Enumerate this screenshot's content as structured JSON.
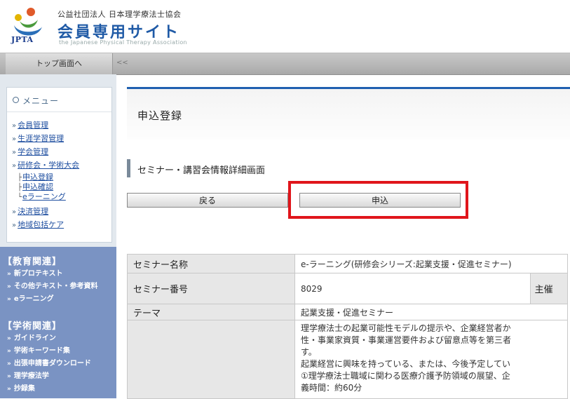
{
  "header": {
    "org_name": "公益社団法人 日本理学療法士協会",
    "site_title": "会員専用サイト",
    "site_subtitle": "the Japanese Physical Therapy Association",
    "logo_text": "JPTA"
  },
  "nav": {
    "top_button": "トップ画面へ",
    "collapse": "<<"
  },
  "menu": {
    "title": "メニュー",
    "items": [
      "会員管理",
      "生涯学習管理",
      "学会管理",
      "研修会・学術大会",
      "決済管理",
      "地域包括ケア"
    ],
    "sub_items": [
      "申込登録",
      "申込確認",
      "eラーニング"
    ]
  },
  "education": {
    "title": "【教育関連】",
    "items": [
      "新プロテキスト",
      "その他テキスト・参考資料",
      "eラーニング"
    ]
  },
  "academic": {
    "title": "【学術関連】",
    "items": [
      "ガイドライン",
      "学術キーワード集",
      "出張申請書ダウンロード",
      "理学療法学",
      "抄録集"
    ]
  },
  "main": {
    "page_title": "申込登録",
    "sub_title": "セミナー・講習会情報詳細画面",
    "back_button": "戻る",
    "apply_button": "申込"
  },
  "details": {
    "rows": [
      {
        "label": "セミナー名称",
        "value": "e-ラーニング(研修会シリーズ:起業支援・促進セミナー)"
      },
      {
        "label": "セミナー番号",
        "value": "8029",
        "extra_label": "主催"
      },
      {
        "label": "テーマ",
        "value": "起業支援・促進セミナー"
      }
    ],
    "description_lines": [
      "理学療法士の起業可能性モデルの提示や、企業経営者か",
      "性・事業家資質・事業運営要件および留意点等を第三者",
      "す。",
      "起業経営に興味を持っている、または、今後予定してい",
      "①理学療法士職域に関わる医療介護予防領域の展望、企",
      "義時間：約60分"
    ]
  },
  "colors": {
    "accent_blue": "#2060b0",
    "sidebar_blue": "#7a93c3",
    "highlight_red": "#e0151b"
  }
}
